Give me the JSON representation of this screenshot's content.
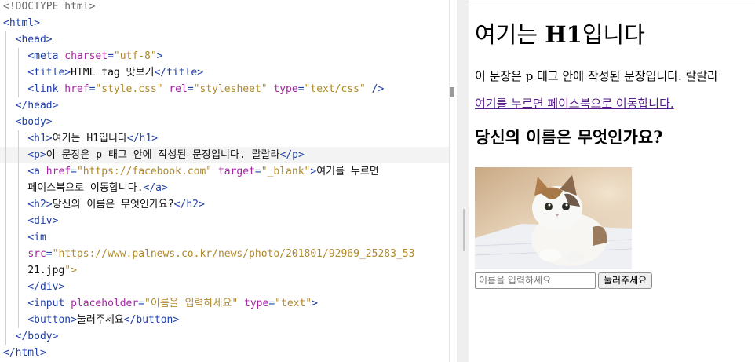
{
  "editor": {
    "lines": [
      "<!DOCTYPE html>",
      "<html>",
      "  <head>",
      "    <meta charset=\"utf-8\">",
      "    <title>HTML tag 맛보기</title>",
      "    <link href=\"style.css\" rel=\"stylesheet\" type=\"text/css\" />",
      "  </head>",
      "  <body>",
      "    <h1>여기는 H1입니다</h1>",
      "    <p>이 문장은 p 태그 안에 작성된 문장입니다. 랄랄라</p>",
      "    <a href=\"https://facebook.com\" target=\"_blank\">여기를 누르면",
      "    페이스북으로 이동합니다.</a>",
      "    <h2>당신의 이름은 무엇인가요?</h2>",
      "    <div>",
      "    <img",
      "    src=\"https://www.palnews.co.kr/news/photo/201801/92969_25283_53",
      "    21.jpg\">",
      "    </div>",
      "    <input placeholder=\"이름을 입력하세요\" type=\"text\">",
      "    <button>눌러주세요</button>",
      "  </body>",
      "</html>"
    ]
  },
  "preview": {
    "h1_prefix": "여기는 ",
    "h1_bold": "H1",
    "h1_suffix": "입니다",
    "paragraph": "이 문장은 p 태그 안에 작성된 문장입니다. 랄랄라",
    "link_text": "여기를 누르면 페이스북으로 이동합니다.",
    "h2": "당신의 이름은 무엇인가요?",
    "image_icon": "cat-photo",
    "input_placeholder": "이름을 입력하세요",
    "button_label": "눌러주세요"
  }
}
